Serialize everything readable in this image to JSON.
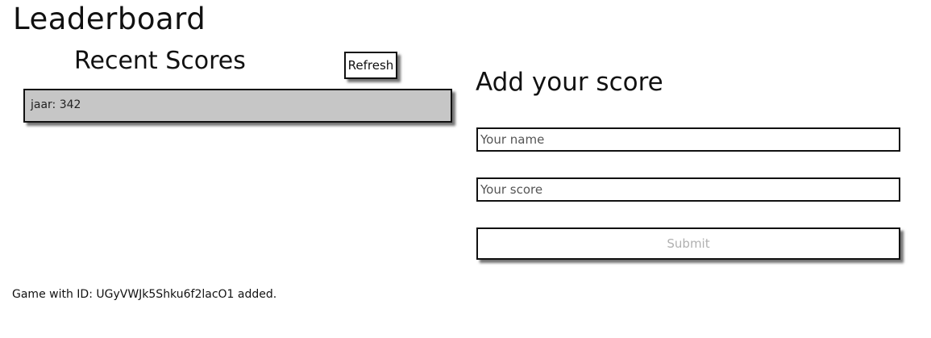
{
  "page": {
    "title": "Leaderboard"
  },
  "recent": {
    "title": "Recent Scores",
    "refresh_label": "Refresh",
    "scores": [
      {
        "text": "jaar: 342"
      }
    ]
  },
  "form": {
    "title": "Add your score",
    "name_placeholder": "Your name",
    "score_placeholder": "Your score",
    "submit_label": "Submit"
  },
  "status": {
    "message": "Game with ID: UGyVWJk5Shku6f2lacO1 added."
  },
  "colors": {
    "list_background": "#c6c6c6",
    "submit_text": "#b0b0b0"
  }
}
